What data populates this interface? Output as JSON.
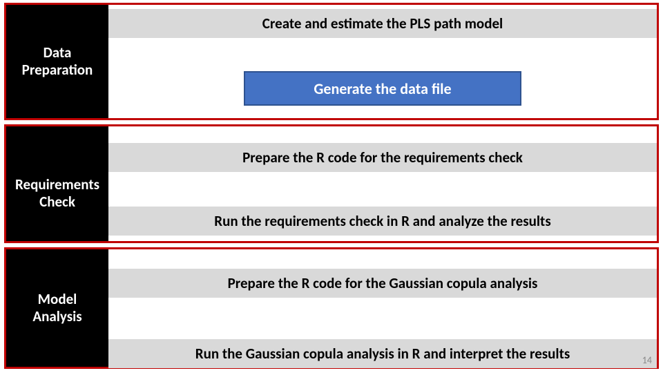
{
  "sections": [
    {
      "label": "Data\nPreparation",
      "band1": "Create and estimate the PLS path model",
      "box": "Generate the data file"
    },
    {
      "label": "Requirements\nCheck",
      "band1": "Prepare the R code for the requirements check",
      "band2": "Run the requirements check in R and analyze the results"
    },
    {
      "label": "Model\nAnalysis",
      "band1": "Prepare the R code for the Gaussian copula analysis",
      "band2": "Run the Gaussian copula analysis in R and interpret the results"
    }
  ],
  "page_number": "14"
}
